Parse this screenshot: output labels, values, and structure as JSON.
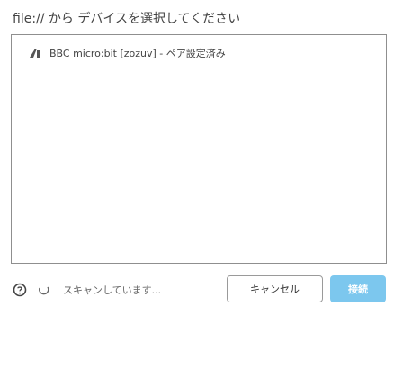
{
  "window": {
    "title": "file:// から デバイスを選択してください"
  },
  "device_list": {
    "items": [
      {
        "label": "BBC micro:bit [zozuv] - ペア設定済み",
        "icon": "device-usb-icon"
      }
    ]
  },
  "footer": {
    "help_icon": "help-icon",
    "status_icon": "search-spinner-icon",
    "status_text": "スキャンしています...",
    "cancel_label": "キャンセル",
    "connect_label": "接続",
    "connect_color": "#7cc7ee"
  }
}
